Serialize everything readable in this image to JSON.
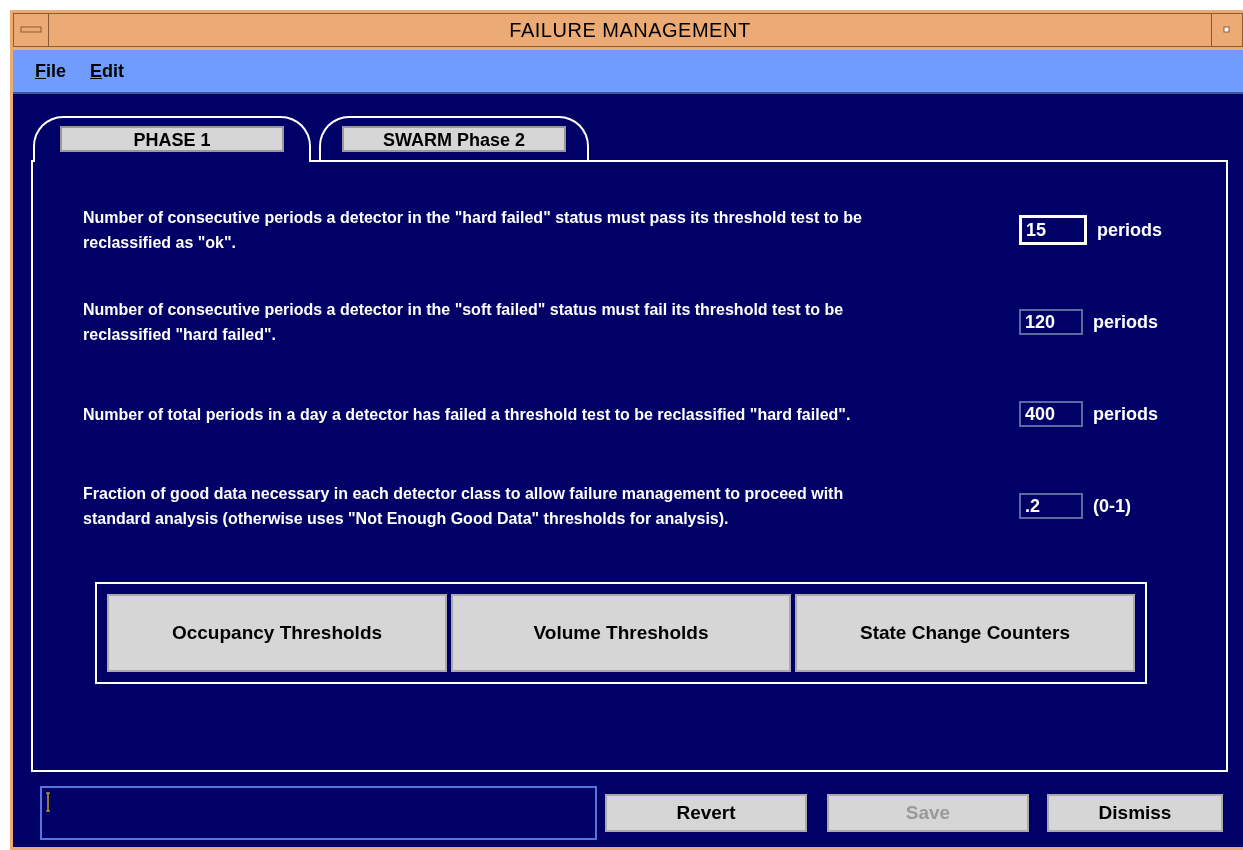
{
  "window": {
    "title": "FAILURE MANAGEMENT"
  },
  "menu": [
    {
      "label": "File"
    },
    {
      "label": "Edit"
    }
  ],
  "tabs": [
    {
      "label": "PHASE 1",
      "selected": true
    },
    {
      "label": "SWARM Phase 2",
      "selected": false
    }
  ],
  "settings": [
    {
      "description": "Number of consecutive periods a detector in the \"hard failed\" status must pass its threshold test to be reclassified as \"ok\".",
      "value": "15",
      "unit": "periods",
      "focused": true
    },
    {
      "description": "Number of consecutive periods a detector in the \"soft failed\" status must fail its threshold test to be reclassified \"hard failed\".",
      "value": "120",
      "unit": "periods",
      "focused": false
    },
    {
      "description": "Number of total periods in a day a detector has failed a threshold test to be reclassified \"hard failed\".",
      "value": "400",
      "unit": "periods",
      "focused": false
    },
    {
      "description": "Fraction of good data necessary in each detector class to allow failure management to proceed with standard analysis (otherwise uses \"Not Enough Good Data\" thresholds for analysis).",
      "value": ".2",
      "unit": "(0-1)",
      "focused": false
    }
  ],
  "threshold_buttons": [
    {
      "label": "Occupancy Thresholds"
    },
    {
      "label": "Volume Thresholds"
    },
    {
      "label": "State Change Counters"
    }
  ],
  "actions": [
    {
      "label": "Revert",
      "disabled": false
    },
    {
      "label": "Save",
      "disabled": true
    },
    {
      "label": "Dismiss",
      "disabled": false
    }
  ]
}
